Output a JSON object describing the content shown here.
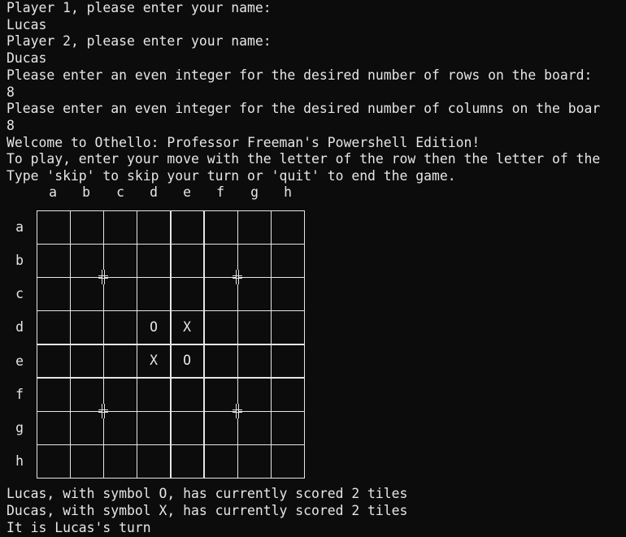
{
  "window": {
    "background": "#0c0c0c",
    "foreground": "#e6e6e6"
  },
  "transcript": [
    "Player 1, please enter your name:",
    "Lucas",
    "Player 2, please enter your name:",
    "Ducas",
    "Please enter an even integer for the desired number of rows on the board:",
    "8",
    "Please enter an even integer for the desired number of columns on the boar",
    "8",
    "Welcome to Othello: Professor Freeman's Powershell Edition!",
    "To play, enter your move with the letter of the row then the letter of the",
    "Type 'skip' to skip your turn or 'quit' to end the game."
  ],
  "board": {
    "column_labels": [
      "a",
      "b",
      "c",
      "d",
      "e",
      "f",
      "g",
      "h"
    ],
    "row_labels": [
      "a",
      "b",
      "c",
      "d",
      "e",
      "f",
      "g",
      "h"
    ],
    "pieces": [
      {
        "row": "d",
        "col": "d",
        "symbol": "O"
      },
      {
        "row": "d",
        "col": "e",
        "symbol": "X"
      },
      {
        "row": "e",
        "col": "d",
        "symbol": "X"
      },
      {
        "row": "e",
        "col": "e",
        "symbol": "O"
      }
    ],
    "star_points": [
      {
        "row": "b",
        "col": "b",
        "icon": "star-point-icon"
      },
      {
        "row": "b",
        "col": "f",
        "icon": "star-point-icon"
      },
      {
        "row": "f",
        "col": "b",
        "icon": "star-point-icon"
      },
      {
        "row": "f",
        "col": "f",
        "icon": "star-point-icon"
      }
    ]
  },
  "status": [
    "Lucas, with symbol O, has currently scored 2 tiles",
    "Ducas, with symbol X, has currently scored 2 tiles",
    "It is Lucas's turn"
  ]
}
